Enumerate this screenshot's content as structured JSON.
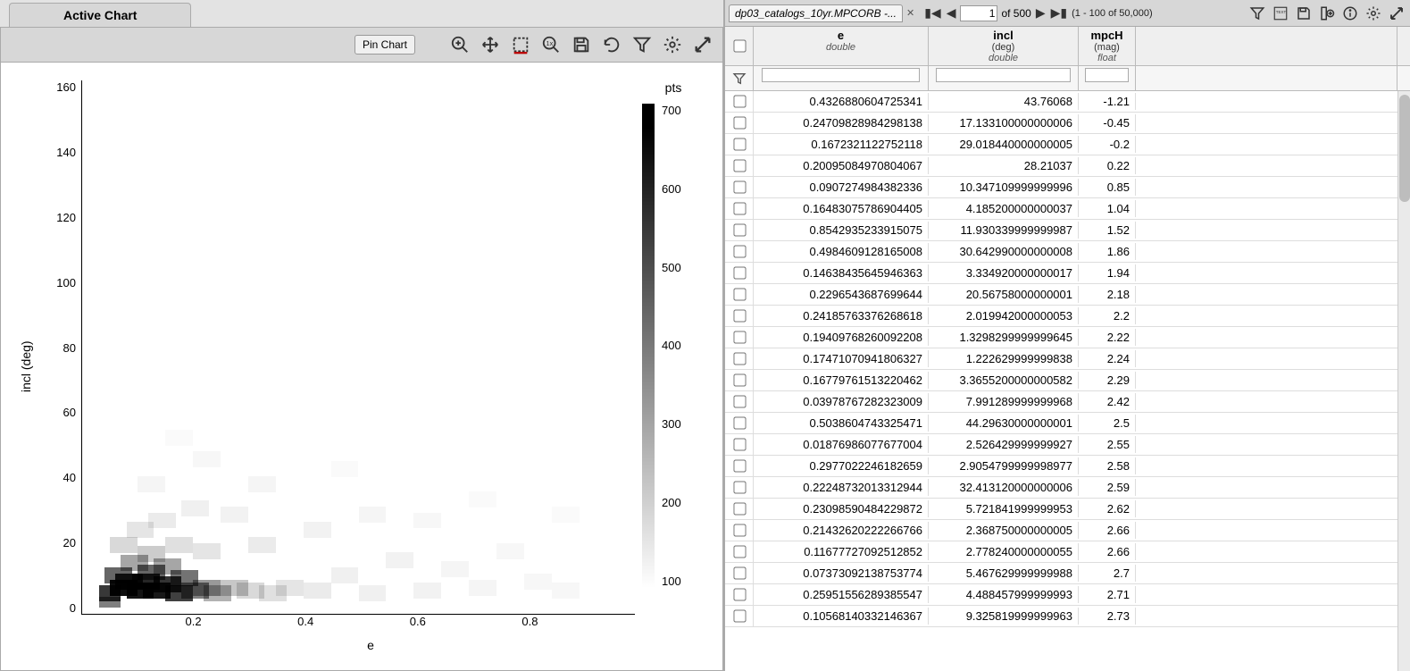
{
  "tab_label": "Active Chart",
  "pin_label": "Pin Chart",
  "chart_data": {
    "type": "heatmap",
    "title": "",
    "xlabel": "e",
    "ylabel": "incl (deg)",
    "legend_title": "pts",
    "xlim": [
      0,
      1.0
    ],
    "ylim": [
      0,
      175
    ],
    "x_ticks": [
      0.2,
      0.4,
      0.6,
      0.8
    ],
    "y_ticks": [
      0,
      20,
      40,
      60,
      80,
      100,
      120,
      140,
      160
    ],
    "colorbar_ticks": [
      700,
      600,
      500,
      400,
      300,
      200,
      100
    ],
    "note": "2D density of (e, incl) points; highest density near e≈0.05–0.15, incl≈2–10 deg, peaking ~700 pts; sparse low-density scatter spreads across e 0–0.9 and incl 0–60"
  },
  "data_panel": {
    "tab_name": "dp03_catalogs_10yr.MPCORB -...",
    "page_current": "1",
    "page_total_label": "of 500",
    "row_range_label": "(1 - 100 of 50,000)"
  },
  "columns": [
    {
      "key": "e",
      "name": "e",
      "unit": "",
      "type": "double"
    },
    {
      "key": "incl",
      "name": "incl",
      "unit": "(deg)",
      "type": "double"
    },
    {
      "key": "mpch",
      "name": "mpcH",
      "unit": "(mag)",
      "type": "float"
    }
  ],
  "rows": [
    {
      "e": "0.4326880604725341",
      "incl": "43.76068",
      "mpch": "-1.21"
    },
    {
      "e": "0.24709828984298138",
      "incl": "17.133100000000006",
      "mpch": "-0.45"
    },
    {
      "e": "0.1672321122752118",
      "incl": "29.018440000000005",
      "mpch": "-0.2"
    },
    {
      "e": "0.20095084970804067",
      "incl": "28.21037",
      "mpch": "0.22"
    },
    {
      "e": "0.0907274984382336",
      "incl": "10.347109999999996",
      "mpch": "0.85"
    },
    {
      "e": "0.16483075786904405",
      "incl": "4.185200000000037",
      "mpch": "1.04"
    },
    {
      "e": "0.8542935233915075",
      "incl": "11.930339999999987",
      "mpch": "1.52"
    },
    {
      "e": "0.4984609128165008",
      "incl": "30.642990000000008",
      "mpch": "1.86"
    },
    {
      "e": "0.14638435645946363",
      "incl": "3.334920000000017",
      "mpch": "1.94"
    },
    {
      "e": "0.2296543687699644",
      "incl": "20.56758000000001",
      "mpch": "2.18"
    },
    {
      "e": "0.24185763376268618",
      "incl": "2.019942000000053",
      "mpch": "2.2"
    },
    {
      "e": "0.19409768260092208",
      "incl": "1.3298299999999645",
      "mpch": "2.22"
    },
    {
      "e": "0.17471070941806327",
      "incl": "1.222629999999838",
      "mpch": "2.24"
    },
    {
      "e": "0.16779761513220462",
      "incl": "3.3655200000000582",
      "mpch": "2.29"
    },
    {
      "e": "0.03978767282323009",
      "incl": "7.991289999999968",
      "mpch": "2.42"
    },
    {
      "e": "0.5038604743325471",
      "incl": "44.29630000000001",
      "mpch": "2.5"
    },
    {
      "e": "0.01876986077677004",
      "incl": "2.526429999999927",
      "mpch": "2.55"
    },
    {
      "e": "0.2977022246182659",
      "incl": "2.9054799999998977",
      "mpch": "2.58"
    },
    {
      "e": "0.22248732013312944",
      "incl": "32.413120000000006",
      "mpch": "2.59"
    },
    {
      "e": "0.23098590484229872",
      "incl": "5.721841999999953",
      "mpch": "2.62"
    },
    {
      "e": "0.21432620222266766",
      "incl": "2.368750000000005",
      "mpch": "2.66"
    },
    {
      "e": "0.11677727092512852",
      "incl": "2.778240000000055",
      "mpch": "2.66"
    },
    {
      "e": "0.07373092138753774",
      "incl": "5.467629999999988",
      "mpch": "2.7"
    },
    {
      "e": "0.25951556289385547",
      "incl": "4.488457999999993",
      "mpch": "2.71"
    },
    {
      "e": "0.10568140332146367",
      "incl": "9.325819999999963",
      "mpch": "2.73"
    }
  ]
}
